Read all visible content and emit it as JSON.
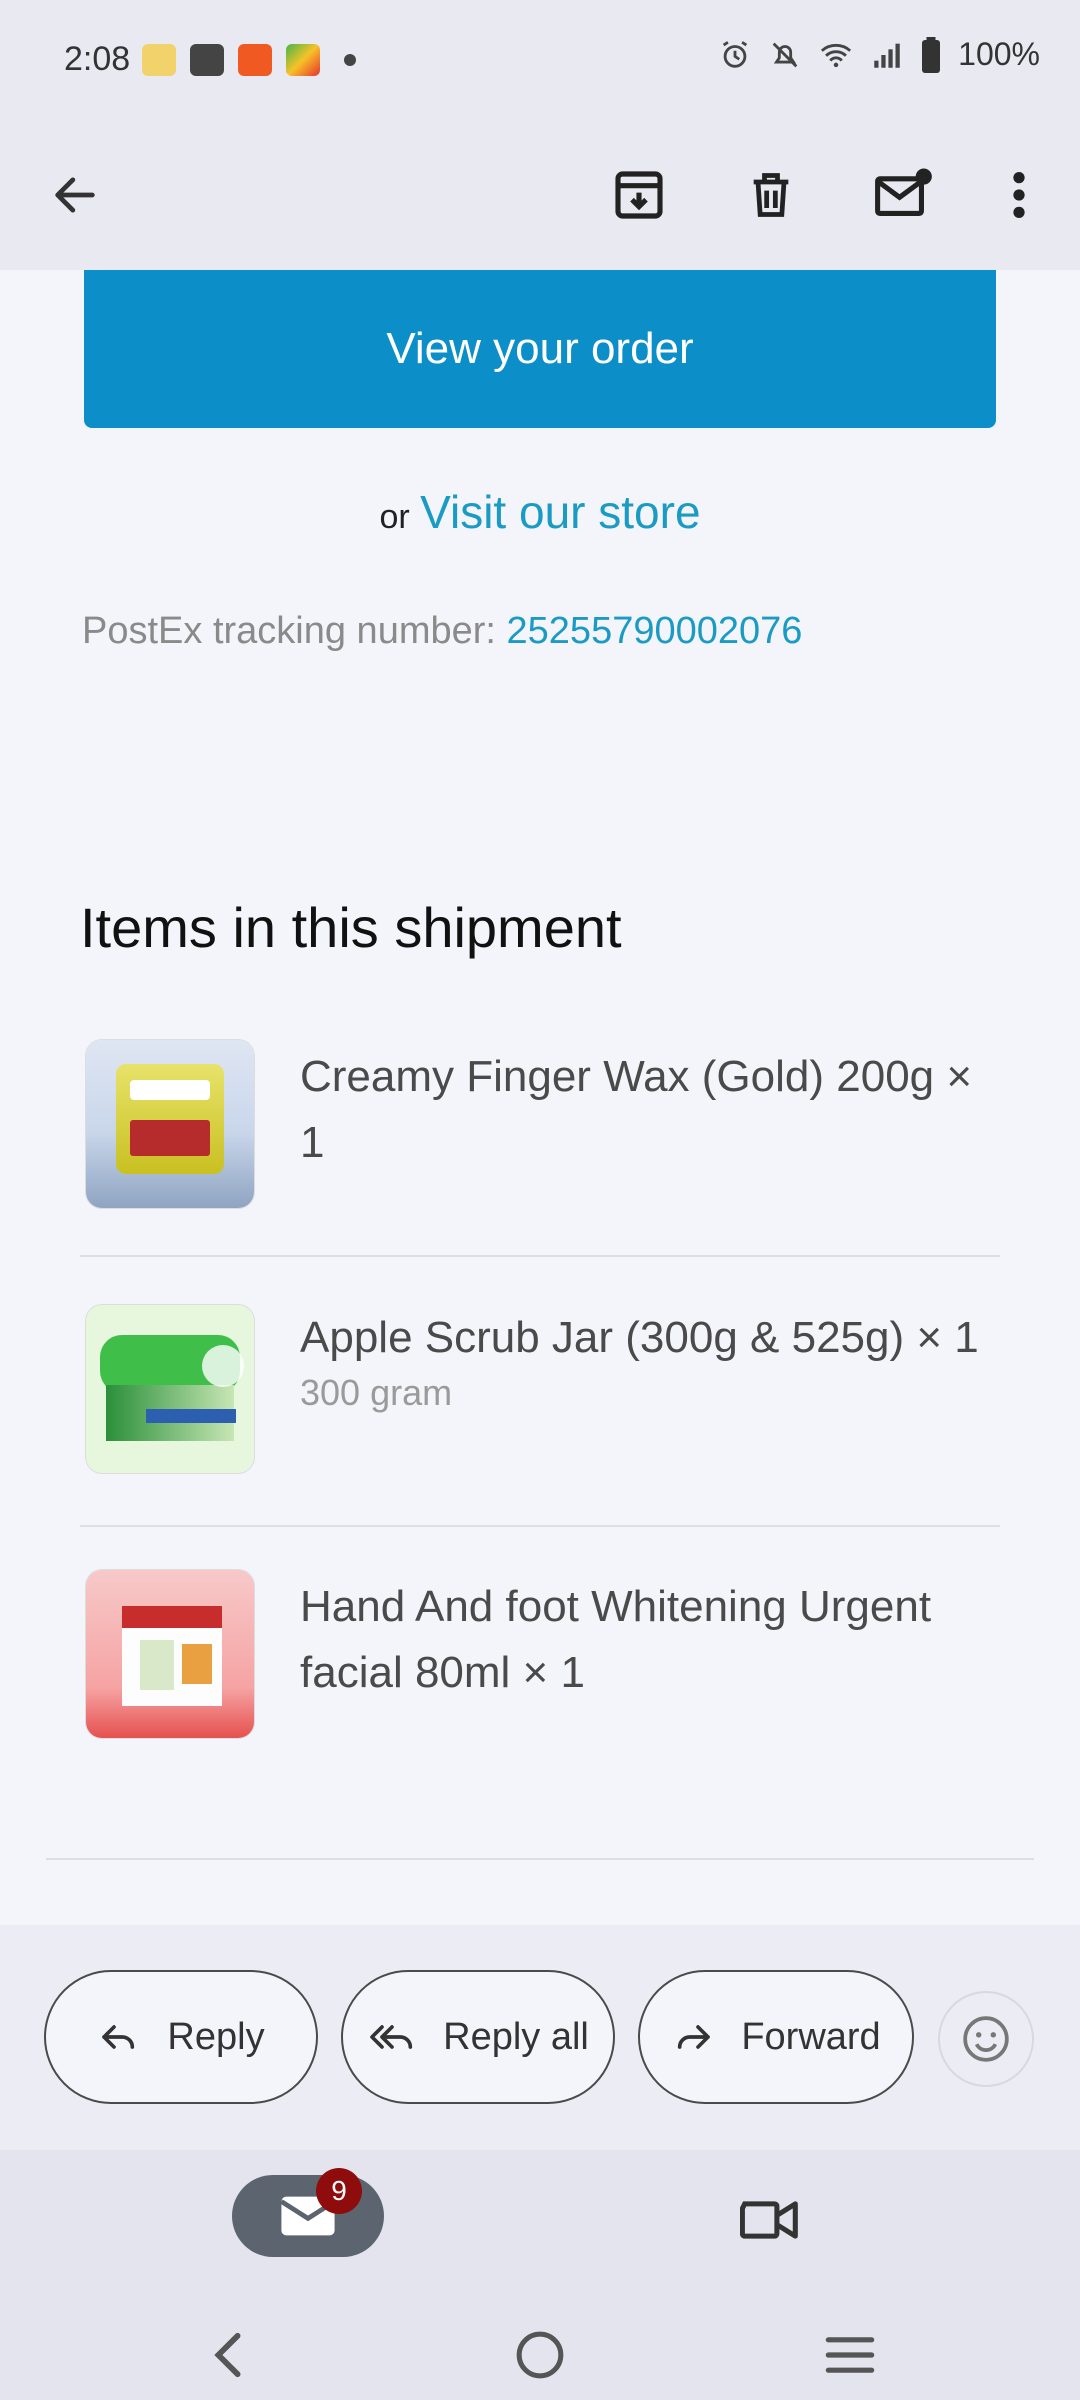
{
  "status_bar": {
    "time": "2:08",
    "battery": "100%"
  },
  "toolbar": {
    "back": "back-arrow-icon",
    "archive": "archive-icon",
    "delete": "delete-icon",
    "mark_unread": "mark-unread-icon",
    "more": "more-vert-icon"
  },
  "email": {
    "view_order_label": "View your order",
    "or_text": "or",
    "visit_store_label": "Visit our store",
    "tracking_label": "PostEx tracking number:",
    "tracking_number": "25255790002076",
    "items_title": "Items in this shipment",
    "items": [
      {
        "name": "Creamy Finger Wax (Gold) 200g × 1",
        "variant": ""
      },
      {
        "name": "Apple Scrub Jar (300g & 525g) × 1",
        "variant": "300 gram"
      },
      {
        "name": "Hand And foot Whitening Urgent facial 80ml × 1",
        "variant": ""
      }
    ]
  },
  "actions": {
    "reply": "Reply",
    "reply_all": "Reply all",
    "forward": "Forward"
  },
  "bottom_nav": {
    "mail_badge": "9"
  },
  "colors": {
    "accent": "#0c8fc8",
    "link": "#1a9bc4",
    "badge": "#8e0c0c"
  }
}
